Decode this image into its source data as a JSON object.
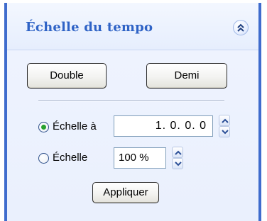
{
  "panel": {
    "title": "Échelle du tempo",
    "collapse_icon": "double-chevron-up-icon",
    "accent_color": "#3f6ccd",
    "title_color": "#2f63c6"
  },
  "buttons": {
    "double_label": "Double",
    "demi_label": "Demi",
    "apply_label": "Appliquer"
  },
  "options": [
    {
      "label": "Échelle à",
      "selected": true,
      "value": "1.  0.  0.   0"
    },
    {
      "label": "Échelle",
      "selected": false,
      "value": "100 %"
    }
  ]
}
